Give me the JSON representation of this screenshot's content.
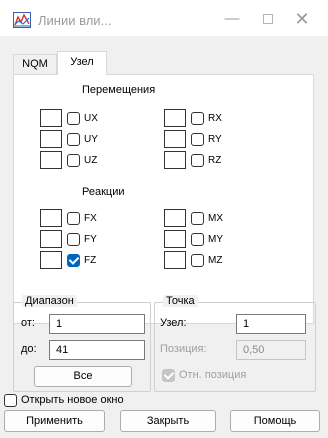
{
  "window": {
    "title": "Линии вли...",
    "minimize_glyph": "—",
    "close_glyph": "✕",
    "icon": "chart-lines-icon"
  },
  "tabs": [
    {
      "label": "NQM",
      "active": false
    },
    {
      "label": "Узел",
      "active": true
    }
  ],
  "displacements": {
    "title": "Перемещения",
    "left": [
      {
        "label": "UX",
        "checked": false
      },
      {
        "label": "UY",
        "checked": false
      },
      {
        "label": "UZ",
        "checked": false
      }
    ],
    "right": [
      {
        "label": "RX",
        "checked": false
      },
      {
        "label": "RY",
        "checked": false
      },
      {
        "label": "RZ",
        "checked": false
      }
    ]
  },
  "reactions": {
    "title": "Реакции",
    "left": [
      {
        "label": "FX",
        "checked": false
      },
      {
        "label": "FY",
        "checked": false
      },
      {
        "label": "FZ",
        "checked": true
      }
    ],
    "right": [
      {
        "label": "MX",
        "checked": false
      },
      {
        "label": "MY",
        "checked": false
      },
      {
        "label": "MZ",
        "checked": false
      }
    ]
  },
  "range": {
    "title": "Диапазон",
    "from_label": "от:",
    "from_value": "1",
    "to_label": "до:",
    "to_value": "41",
    "all_button": "Все"
  },
  "point": {
    "title": "Точка",
    "node_label": "Узел:",
    "node_value": "1",
    "position_label": "Позиция:",
    "position_value": "0,50",
    "relative_label": "Отн. позиция",
    "relative_checked": true
  },
  "open_new_window": {
    "label": "Открыть новое окно",
    "checked": false
  },
  "buttons": {
    "apply": "Применить",
    "close": "Закрыть",
    "help": "Помощь"
  },
  "colors": {
    "accent": "#0067c0",
    "window_bg": "#f0f0f0",
    "panel_bg": "#ffffff"
  }
}
